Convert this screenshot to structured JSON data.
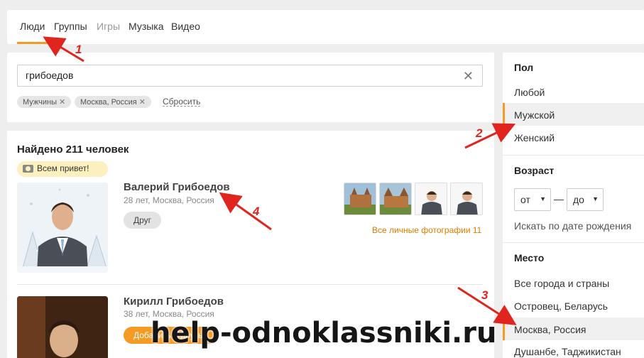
{
  "tabs": [
    {
      "label": "Люди",
      "active": true
    },
    {
      "label": "Группы"
    },
    {
      "label": "Игры",
      "disabled": true
    },
    {
      "label": "Музыка"
    },
    {
      "label": "Видео"
    }
  ],
  "search": {
    "value": "грибоедов",
    "clear_icon": "close-icon",
    "chips": [
      "Мужчины",
      "Москва, Россия"
    ],
    "reset_label": "Сбросить"
  },
  "results": {
    "found_label": "Найдено 211 человек",
    "status_text": "Всем привет!",
    "people": [
      {
        "name": "Валерий Грибоедов",
        "meta": "28 лет, Москва, Россия",
        "button": "Друг",
        "all_photos": "Все личные фотографии 11"
      },
      {
        "name": "Кирилл Грибоедов",
        "meta": "38 лет, Москва, Россия",
        "button": "Добавить в друзья"
      }
    ]
  },
  "filters": {
    "gender": {
      "heading": "Пол",
      "options": [
        "Любой",
        "Мужской",
        "Женский"
      ],
      "selected": "Мужской"
    },
    "age": {
      "heading": "Возраст",
      "from": "от",
      "to": "до",
      "dash": "—",
      "birthday_link": "Искать по дате рождения"
    },
    "place": {
      "heading": "Место",
      "options": [
        "Все города и страны",
        "Островец, Беларусь",
        "Москва, Россия",
        "Душанбе, Таджикистан"
      ],
      "selected": "Москва, Россия"
    }
  },
  "annotations": {
    "numbers": [
      "1",
      "2",
      "3",
      "4"
    ],
    "color": "#e0251f"
  },
  "watermark": "help-odnoklassniki.ru",
  "colors": {
    "accent": "#f59a23",
    "link": "#e07b00",
    "background": "#eeeeee"
  }
}
